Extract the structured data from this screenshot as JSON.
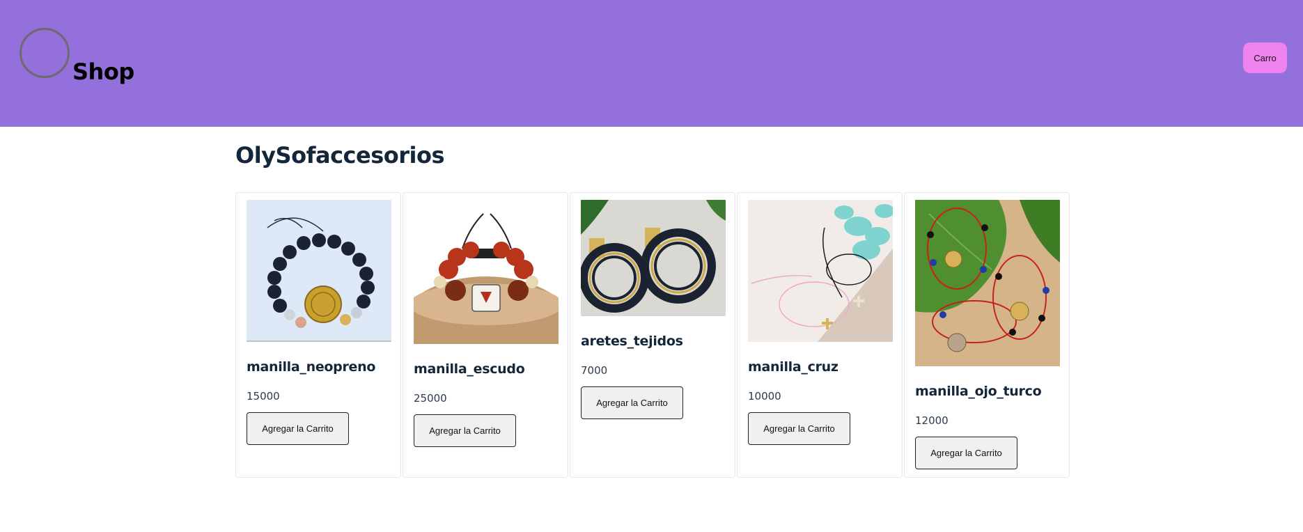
{
  "header": {
    "brand": "Shop",
    "cart_label": "Carro",
    "bg_color": "#9370db",
    "cart_color": "#ee82ee"
  },
  "store": {
    "title": "OlySofaccesorios"
  },
  "products": [
    {
      "name": "manilla_neopreno",
      "price": "15000",
      "button_label": "Agregar la Carrito",
      "image": "bracelet-black-beads-gold-medal"
    },
    {
      "name": "manilla_escudo",
      "price": "25000",
      "button_label": "Agregar la Carrito",
      "image": "bracelet-red-beads-shield"
    },
    {
      "name": "aretes_tejidos",
      "price": "7000",
      "button_label": "Agregar la Carrito",
      "image": "woven-hoop-earrings"
    },
    {
      "name": "manilla_cruz",
      "price": "10000",
      "button_label": "Agregar la Carrito",
      "image": "bracelets-cross-pendant"
    },
    {
      "name": "manilla_ojo_turco",
      "price": "12000",
      "button_label": "Agregar la Carrito",
      "image": "bracelets-evil-eye"
    }
  ]
}
